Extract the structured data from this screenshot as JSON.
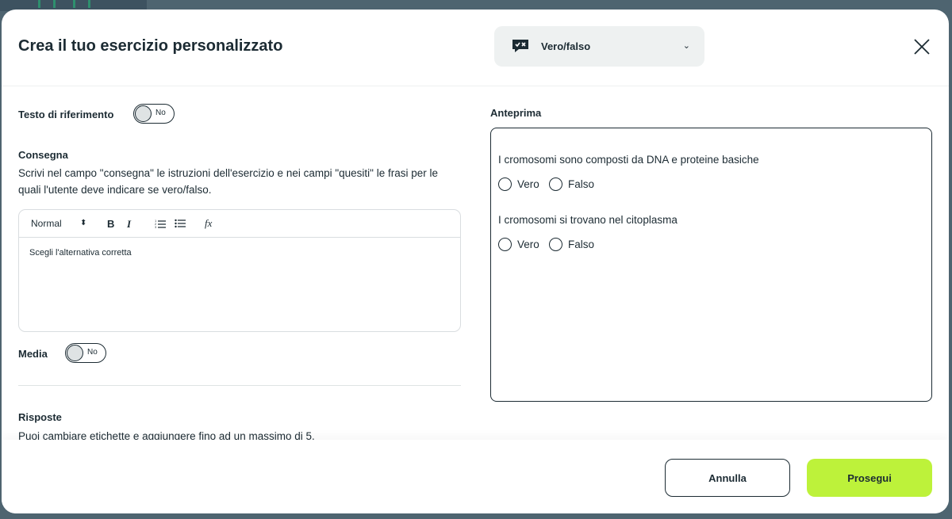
{
  "header": {
    "title": "Crea il tuo esercizio personalizzato",
    "type_select": {
      "icon": "true-false-icon",
      "value": "Vero/falso"
    }
  },
  "reference_text": {
    "label": "Testo di riferimento",
    "toggle_text": "No"
  },
  "instructions": {
    "label": "Consegna",
    "description": "Scrivi nel campo \"consegna\" le istruzioni dell'esercizio e nei campi \"quesiti\" le frasi per le quali l'utente deve indicare se vero/falso.",
    "editor": {
      "format_value": "Normal",
      "bold": "B",
      "italic": "I",
      "formula": "fx",
      "content": "Scegli l'alternativa corretta"
    }
  },
  "media": {
    "label": "Media",
    "toggle_text": "No"
  },
  "answers": {
    "label": "Risposte",
    "description": "Puoi cambiare etichette e aggiungere fino ad un massimo di 5."
  },
  "preview": {
    "label": "Anteprima",
    "questions": [
      {
        "text": "I cromosomi sono composti da DNA e proteine basiche",
        "options": [
          "Vero",
          "Falso"
        ]
      },
      {
        "text": "I cromosomi si trovano nel citoplasma",
        "options": [
          "Vero",
          "Falso"
        ]
      }
    ]
  },
  "footer": {
    "cancel_label": "Annulla",
    "next_label": "Prosegui"
  },
  "colors": {
    "accent": "#bdf23a",
    "text": "#1c2b33",
    "backdrop": "#4e6470"
  }
}
